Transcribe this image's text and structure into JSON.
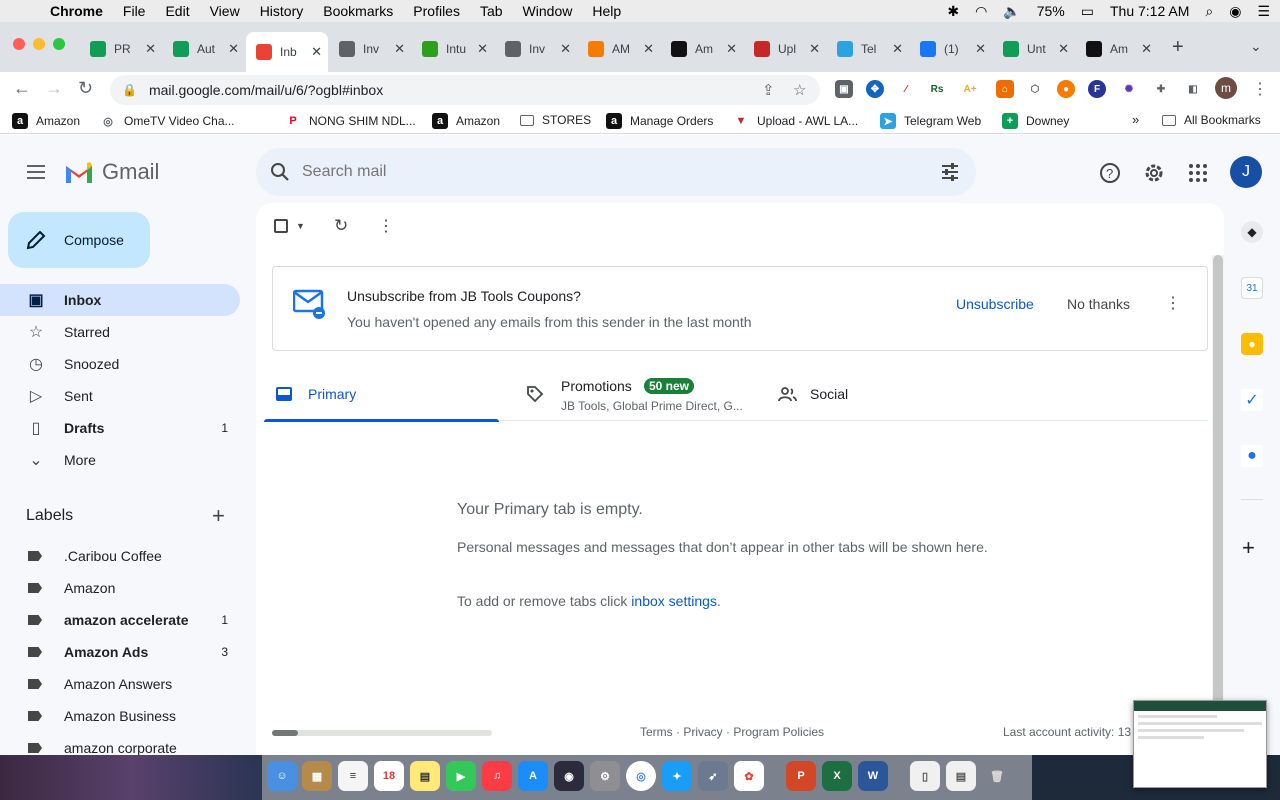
{
  "menubar": {
    "app": "Chrome",
    "items": [
      "File",
      "Edit",
      "View",
      "History",
      "Bookmarks",
      "Profiles",
      "Tab",
      "Window",
      "Help"
    ],
    "battery": "75%",
    "clock": "Thu 7:12 AM"
  },
  "tabs": [
    {
      "title": "PR",
      "icon": "sheets-icon",
      "color": "#0f9d58"
    },
    {
      "title": "Aut",
      "icon": "sheets-icon",
      "color": "#0f9d58"
    },
    {
      "title": "Inb",
      "icon": "gmail-icon",
      "color": "#ea4335",
      "active": true
    },
    {
      "title": "Inv",
      "icon": "globe-icon",
      "color": "#5f6368"
    },
    {
      "title": "Intu",
      "icon": "quickbooks-icon",
      "color": "#2ca01c"
    },
    {
      "title": "Inv",
      "icon": "globe-icon",
      "color": "#5f6368"
    },
    {
      "title": "AM",
      "icon": "pen-icon",
      "color": "#f57c00"
    },
    {
      "title": "Am",
      "icon": "amazon-icon",
      "color": "#111111"
    },
    {
      "title": "Upl",
      "icon": "awl-icon",
      "color": "#c62828"
    },
    {
      "title": "Tel",
      "icon": "telegram-icon",
      "color": "#2aa3df"
    },
    {
      "title": "(1)",
      "icon": "facebook-icon",
      "color": "#1877f2"
    },
    {
      "title": "Unt",
      "icon": "sheets-icon",
      "color": "#0f9d58"
    },
    {
      "title": "Am",
      "icon": "amazon-icon",
      "color": "#111111"
    }
  ],
  "omnibox": {
    "url": "mail.google.com/mail/u/6/?ogbl#inbox"
  },
  "profile_initial": "m",
  "bookmarks": [
    {
      "label": "Amazon",
      "icon": "amazon-icon",
      "color": "#111111",
      "glyph": "a"
    },
    {
      "label": "OmeTV Video Cha...",
      "icon": "globe-icon",
      "color": "#5f6368",
      "glyph": "◎"
    },
    {
      "label": "NONG SHIM NDL...",
      "icon": "pinterest-icon",
      "color": "#e60023",
      "glyph": "P"
    },
    {
      "label": "Amazon",
      "icon": "amazon-icon",
      "color": "#111111",
      "glyph": "a"
    },
    {
      "label": "STORES",
      "icon": "folder-icon",
      "color": "#ffffff",
      "glyph": ""
    },
    {
      "label": "Manage Orders",
      "icon": "amazon-icon",
      "color": "#111111",
      "glyph": "a"
    },
    {
      "label": "Upload - AWL LA...",
      "icon": "awl-icon",
      "color": "#c62828",
      "glyph": "▼"
    },
    {
      "label": "Telegram Web",
      "icon": "telegram-icon",
      "color": "#2aa3df",
      "glyph": "➤"
    },
    {
      "label": "Downey",
      "icon": "sheets-icon",
      "color": "#0f9d58",
      "glyph": "+"
    }
  ],
  "bookmarks_overflow": "»",
  "all_bookmarks": "All Bookmarks",
  "gmail": {
    "brand": "Gmail",
    "search_placeholder": "Search mail",
    "account_initial": "J",
    "compose": "Compose",
    "nav": [
      {
        "label": "Inbox",
        "icon": "inbox-icon",
        "active": true,
        "count": ""
      },
      {
        "label": "Starred",
        "icon": "star-icon",
        "count": ""
      },
      {
        "label": "Snoozed",
        "icon": "clock-icon",
        "count": ""
      },
      {
        "label": "Sent",
        "icon": "send-icon",
        "count": ""
      },
      {
        "label": "Drafts",
        "icon": "draft-icon",
        "count": "1",
        "bold": true
      },
      {
        "label": "More",
        "icon": "chevron-down-icon",
        "count": ""
      }
    ],
    "labels_title": "Labels",
    "labels": [
      {
        "label": ".Caribou Coffee",
        "count": ""
      },
      {
        "label": "Amazon",
        "count": ""
      },
      {
        "label": "amazon accelerate",
        "count": "1",
        "bold": true
      },
      {
        "label": "Amazon Ads",
        "count": "3",
        "bold": true
      },
      {
        "label": "Amazon Answers",
        "count": ""
      },
      {
        "label": "Amazon Business",
        "count": ""
      },
      {
        "label": "amazon corporate",
        "count": ""
      }
    ],
    "unsubscribe": {
      "title": "Unsubscribe from JB Tools Coupons?",
      "subtitle": "You haven't opened any emails from this sender in the last month",
      "action": "Unsubscribe",
      "dismiss": "No thanks"
    },
    "inbox_tabs": {
      "primary": "Primary",
      "promotions": "Promotions",
      "promotions_badge": "50 new",
      "promotions_senders": "JB Tools, Global Prime Direct, G...",
      "social": "Social"
    },
    "empty": {
      "title": "Your Primary tab is empty.",
      "body": "Personal messages and messages that don’t appear in other tabs will be shown here.",
      "link_prefix": "To add or remove tabs click ",
      "link": "inbox settings",
      "link_suffix": "."
    },
    "footer": "Terms · Privacy · Program Policies",
    "last_activity": "Last account activity: 13"
  },
  "colors": {
    "accent": "#0b57d0",
    "compose_bg": "#c2e7ff",
    "active_nav": "#d3e3fd",
    "badge": "#188038"
  }
}
